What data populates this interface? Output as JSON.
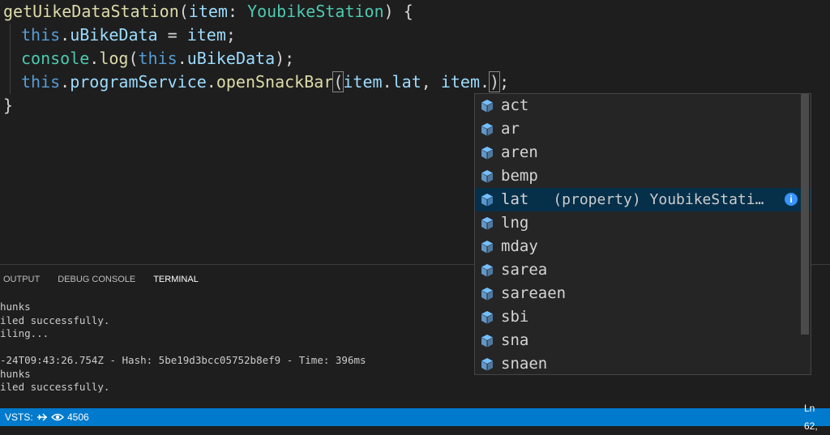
{
  "editor": {
    "line1": {
      "fn": "getUikeDataStation",
      "p1": "(",
      "param": "item",
      "colon": ": ",
      "type": "YoubikeStation",
      "p2": ") {"
    },
    "line2": {
      "this": "this",
      "dot": ".",
      "prop": "uBikeData",
      "rest": " = ",
      "ident": "item",
      "end": ";"
    },
    "line3": {
      "obj": "console",
      "dot": ".",
      "fn": "log",
      "p1": "(",
      "this": "this",
      "dot2": ".",
      "prop": "uBikeData",
      "p2": ");"
    },
    "line4": {
      "this": "this",
      "dot": ".",
      "svc": "programService",
      "dot2": ".",
      "fn": "openSnackBar",
      "p1": "(",
      "arg1": "item",
      "dot3": ".",
      "arg1prop": "lat",
      "comma": ", ",
      "arg2": "item",
      "dot4": ".",
      "p2": ")",
      "end": ";"
    },
    "line5": "}"
  },
  "suggestions": {
    "items": [
      {
        "label": "act"
      },
      {
        "label": "ar"
      },
      {
        "label": "aren"
      },
      {
        "label": "bemp"
      },
      {
        "label": "lat",
        "detail": "(property) YoubikeStati…",
        "selected": true
      },
      {
        "label": "lng"
      },
      {
        "label": "mday"
      },
      {
        "label": "sarea"
      },
      {
        "label": "sareaen"
      },
      {
        "label": "sbi"
      },
      {
        "label": "sna"
      },
      {
        "label": "snaen"
      }
    ],
    "info_glyph": "i",
    "icon": "property-cube-icon",
    "icon_color": "#75beff"
  },
  "panel": {
    "tabs": [
      "OUTPUT",
      "DEBUG CONSOLE",
      "TERMINAL"
    ],
    "active_tab": "TERMINAL",
    "terminal_lines": [
      "hunks",
      "iled successfully.",
      "iling...",
      "",
      "-24T09:43:26.754Z - Hash: 5be19d3bcc05752b8ef9 - Time: 396ms",
      "hunks",
      "iled successfully."
    ]
  },
  "status_bar": {
    "vsts_label": "VSTS:",
    "views_count": "4506",
    "position": "Ln 62,",
    "color": "#007acc"
  }
}
